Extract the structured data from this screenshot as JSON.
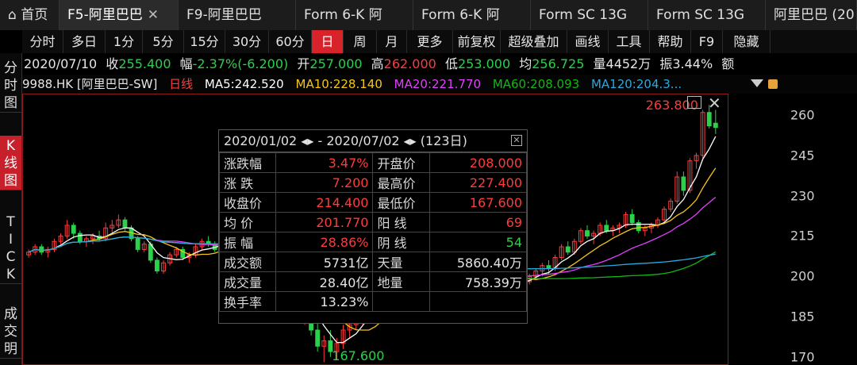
{
  "tabs": [
    {
      "label": "⌂ 首页"
    },
    {
      "label": "F5-阿里巴巴",
      "close": "✕"
    },
    {
      "label": "F9-阿里巴巴"
    },
    {
      "label": "Form 6-K 阿"
    },
    {
      "label": "Form 6-K 阿"
    },
    {
      "label": "Form SC 13G"
    },
    {
      "label": "Form SC 13G"
    },
    {
      "label": "阿里巴巴 (20"
    }
  ],
  "toolbar": [
    "分时",
    "多日",
    "1分",
    "5分",
    "15分",
    "30分",
    "60分",
    "日",
    "周",
    "月",
    "更多",
    "前复权",
    "超级叠加",
    "画线",
    "工具",
    "帮助",
    "F9",
    "隐藏"
  ],
  "toolbar_active": "日",
  "leftnav": [
    {
      "label": "分时图"
    },
    {
      "label": "K线图"
    },
    {
      "label": "TICK"
    },
    {
      "label": "成交明"
    }
  ],
  "quote": {
    "date": "2020/07/10",
    "close_label": "收",
    "close": "255.400",
    "change_label": "幅",
    "change": "-2.37%(-6.200)",
    "open_label": "开",
    "open": "257.000",
    "high_label": "高",
    "high": "262.000",
    "low_label": "低",
    "low": "253.000",
    "avg_label": "均",
    "avg": "256.725",
    "vol_label": "量",
    "vol": "4452万",
    "amp_label": "振",
    "amp": "3.44%",
    "amount_label": "额"
  },
  "legend": {
    "code": "9988.HK [阿里巴巴-SW]",
    "period": "日线",
    "ma5": "MA5:242.520",
    "ma10": "MA10:228.140",
    "ma20": "MA20:221.770",
    "ma60": "MA60:208.093",
    "ma120": "MA120:204.3..."
  },
  "colors": {
    "up": "#ff3b3b",
    "down": "#2bd14a",
    "ma5": "#ffffff",
    "ma10": "#f5c518",
    "ma20": "#e040fb",
    "ma60": "#12b812",
    "ma120": "#2aa8e0",
    "active": "#d8232a"
  },
  "popup": {
    "range_start": "2020/01/02",
    "range_end": "2020/07/02",
    "days": "(123日)",
    "rows": [
      {
        "l1": "涨跌幅",
        "v1": "3.47%",
        "c1": "up",
        "l2": "开盘价",
        "v2": "208.000",
        "c2": "up"
      },
      {
        "l1": "涨 跌",
        "v1": "7.200",
        "c1": "up",
        "l2": "最高价",
        "v2": "227.400",
        "c2": "up"
      },
      {
        "l1": "收盘价",
        "v1": "214.400",
        "c1": "up",
        "l2": "最低价",
        "v2": "167.600",
        "c2": "up"
      },
      {
        "l1": "均 价",
        "v1": "201.770",
        "c1": "up",
        "l2": "阳 线",
        "v2": "69",
        "c2": "up"
      },
      {
        "l1": "振 幅",
        "v1": "28.86%",
        "c1": "up",
        "l2": "阴 线",
        "v2": "54",
        "c2": "dn"
      },
      {
        "l1": "成交额",
        "v1": "5731亿",
        "c1": "wh",
        "l2": "天量",
        "v2": "5860.40万",
        "c2": "wh"
      },
      {
        "l1": "成交量",
        "v1": "28.40亿",
        "c1": "wh",
        "l2": "地量",
        "v2": "758.39万",
        "c2": "wh"
      },
      {
        "l1": "换手率",
        "v1": "13.23%",
        "c1": "wh",
        "l2": "",
        "v2": "",
        "c2": "wh"
      }
    ]
  },
  "chart_data": {
    "type": "candlestick",
    "yticks": [
      170,
      185,
      200,
      215,
      230,
      245,
      260
    ],
    "ylim": [
      167,
      268
    ],
    "annotations": [
      {
        "text": "263.800",
        "value": 263.8,
        "kind": "max"
      },
      {
        "text": "167.600",
        "value": 167.6,
        "kind": "min"
      }
    ],
    "candles": [
      [
        208,
        210,
        207,
        209
      ],
      [
        209,
        212,
        208,
        211
      ],
      [
        211,
        212,
        208,
        209
      ],
      [
        209,
        211,
        207,
        210
      ],
      [
        210,
        214,
        209,
        213
      ],
      [
        213,
        216,
        212,
        215
      ],
      [
        215,
        221,
        214,
        219
      ],
      [
        219,
        220,
        214,
        216
      ],
      [
        216,
        217,
        212,
        213
      ],
      [
        213,
        215,
        211,
        214
      ],
      [
        214,
        216,
        212,
        215
      ],
      [
        215,
        217,
        213,
        214
      ],
      [
        214,
        220,
        213,
        218
      ],
      [
        218,
        221,
        216,
        219
      ],
      [
        219,
        223,
        218,
        221
      ],
      [
        221,
        222,
        217,
        218
      ],
      [
        218,
        219,
        213,
        214
      ],
      [
        214,
        215,
        209,
        210
      ],
      [
        210,
        213,
        209,
        212
      ],
      [
        212,
        213,
        205,
        206
      ],
      [
        206,
        207,
        201,
        202
      ],
      [
        202,
        206,
        201,
        205
      ],
      [
        205,
        209,
        204,
        208
      ],
      [
        208,
        211,
        207,
        210
      ],
      [
        210,
        211,
        206,
        207
      ],
      [
        207,
        209,
        205,
        208
      ],
      [
        208,
        212,
        207,
        211
      ],
      [
        211,
        214,
        210,
        213
      ],
      [
        213,
        215,
        211,
        212
      ],
      [
        212,
        213,
        209,
        210
      ],
      [
        210,
        212,
        208,
        211
      ],
      [
        211,
        213,
        209,
        212
      ],
      [
        212,
        214,
        210,
        213
      ],
      [
        213,
        214,
        210,
        211
      ],
      [
        211,
        213,
        209,
        212
      ],
      [
        212,
        214,
        210,
        213
      ],
      [
        213,
        214,
        211,
        212
      ],
      [
        212,
        213,
        210,
        211
      ],
      [
        211,
        212,
        208,
        209
      ],
      [
        209,
        210,
        205,
        206
      ],
      [
        206,
        207,
        200,
        201
      ],
      [
        201,
        202,
        194,
        195
      ],
      [
        195,
        196,
        186,
        188
      ],
      [
        188,
        192,
        182,
        190
      ],
      [
        190,
        191,
        178,
        180
      ],
      [
        180,
        183,
        172,
        174
      ],
      [
        174,
        178,
        168,
        176
      ],
      [
        176,
        180,
        170,
        172
      ],
      [
        172,
        177,
        169,
        175
      ],
      [
        175,
        182,
        173,
        180
      ],
      [
        180,
        184,
        177,
        182
      ],
      [
        182,
        186,
        180,
        184
      ],
      [
        184,
        189,
        182,
        187
      ],
      [
        187,
        192,
        185,
        190
      ],
      [
        190,
        195,
        188,
        193
      ],
      [
        193,
        197,
        191,
        195
      ],
      [
        195,
        198,
        192,
        194
      ],
      [
        194,
        197,
        192,
        196
      ],
      [
        196,
        199,
        194,
        197
      ],
      [
        197,
        200,
        195,
        198
      ],
      [
        198,
        200,
        196,
        199
      ],
      [
        199,
        201,
        197,
        200
      ],
      [
        200,
        202,
        198,
        201
      ],
      [
        201,
        203,
        199,
        202
      ],
      [
        202,
        204,
        200,
        203
      ],
      [
        203,
        205,
        201,
        202
      ],
      [
        202,
        204,
        199,
        200
      ],
      [
        200,
        202,
        198,
        201
      ],
      [
        201,
        207,
        200,
        206
      ],
      [
        206,
        210,
        204,
        205
      ],
      [
        205,
        206,
        199,
        200
      ],
      [
        200,
        202,
        196,
        197
      ],
      [
        197,
        200,
        195,
        199
      ],
      [
        199,
        201,
        196,
        198
      ],
      [
        198,
        200,
        194,
        196
      ],
      [
        196,
        199,
        195,
        198
      ],
      [
        198,
        201,
        196,
        200
      ],
      [
        200,
        201,
        197,
        198
      ],
      [
        198,
        201,
        197,
        200
      ],
      [
        200,
        203,
        199,
        202
      ],
      [
        202,
        205,
        200,
        204
      ],
      [
        204,
        206,
        201,
        203
      ],
      [
        203,
        208,
        202,
        207
      ],
      [
        207,
        212,
        206,
        211
      ],
      [
        211,
        213,
        208,
        209
      ],
      [
        209,
        214,
        208,
        213
      ],
      [
        213,
        218,
        212,
        217
      ],
      [
        217,
        219,
        214,
        215
      ],
      [
        215,
        217,
        212,
        216
      ],
      [
        216,
        220,
        215,
        219
      ],
      [
        219,
        221,
        216,
        217
      ],
      [
        217,
        219,
        215,
        218
      ],
      [
        218,
        220,
        216,
        219
      ],
      [
        219,
        224,
        218,
        223
      ],
      [
        223,
        225,
        219,
        220
      ],
      [
        220,
        221,
        216,
        217
      ],
      [
        217,
        219,
        215,
        218
      ],
      [
        218,
        220,
        216,
        219
      ],
      [
        219,
        222,
        218,
        221
      ],
      [
        221,
        226,
        220,
        225
      ],
      [
        225,
        229,
        224,
        228
      ],
      [
        228,
        239,
        227,
        237
      ],
      [
        237,
        239,
        230,
        232
      ],
      [
        232,
        244,
        231,
        243
      ],
      [
        243,
        246,
        240,
        245
      ],
      [
        245,
        262,
        244,
        261
      ],
      [
        261,
        263.8,
        255,
        256
      ],
      [
        257,
        262,
        253,
        255.4
      ]
    ],
    "ma_lines": [
      {
        "name": "MA5",
        "color": "#ffffff"
      },
      {
        "name": "MA10",
        "color": "#f5c518"
      },
      {
        "name": "MA20",
        "color": "#e040fb"
      },
      {
        "name": "MA60",
        "color": "#12b812"
      },
      {
        "name": "MA120",
        "color": "#2aa8e0"
      }
    ]
  }
}
